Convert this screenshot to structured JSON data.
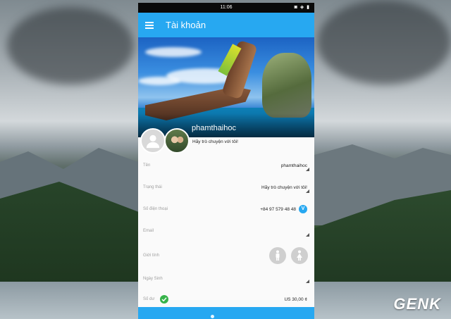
{
  "statusbar": {
    "time": "11:06",
    "icons": "◙ ◈ ▮"
  },
  "appbar": {
    "title": "Tài khoản"
  },
  "profile": {
    "username": "phamthaihoc",
    "status_text": "Hãy trò chuyện với tôi!"
  },
  "fields": [
    {
      "label": "Tên",
      "value": "phamthaihoc"
    },
    {
      "label": "Trạng thái",
      "value": "Hãy trò chuyện với tôi!"
    },
    {
      "label": "Số điện thoại",
      "value": "+84 97 579 48 48",
      "badge": "V"
    },
    {
      "label": "Email",
      "value": ""
    },
    {
      "label": "Giới tính",
      "value": ""
    },
    {
      "label": "Ngày Sinh",
      "value": ""
    },
    {
      "label": "Số dư",
      "value": "US 30,00 ¢"
    }
  ],
  "watermark": {
    "text": "GEN",
    "accent": "K"
  },
  "colors": {
    "accent": "#27a8f1",
    "success": "#37b34a"
  }
}
